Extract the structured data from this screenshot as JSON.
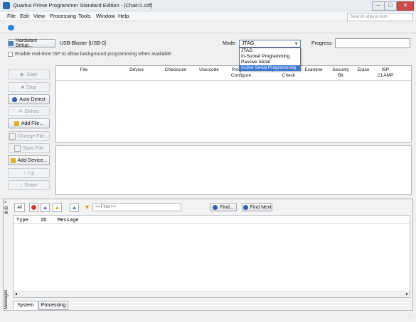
{
  "window": {
    "title": "Quartus Prime Programmer Standard Edition - [Chain1.cdf]",
    "min_label": "–",
    "max_label": "□",
    "close_label": "✕"
  },
  "menu": [
    "File",
    "Edit",
    "View",
    "Processing",
    "Tools",
    "Window",
    "Help"
  ],
  "search": {
    "placeholder": "Search altera.com"
  },
  "hardware": {
    "setup_label": "Hardware Setup...",
    "device": "USB-Blaster [USB-0]",
    "isp_label": "Enable real-time ISP to allow background programming when available"
  },
  "mode": {
    "label": "Mode:",
    "selected": "JTAG",
    "options": [
      "JTAG",
      "In-Socket Programming",
      "Passive Serial",
      "Active Serial Programming"
    ],
    "highlighted_index": 3
  },
  "progress_label": "Progress:",
  "side_buttons": {
    "start": "Start",
    "stop": "Stop",
    "auto_detect": "Auto Detect",
    "delete": "Delete",
    "add_file": "Add File...",
    "change_file": "Change File...",
    "save_file": "Save File",
    "add_device": "Add Device...",
    "up": "Up",
    "down": "Down"
  },
  "columns": {
    "file": "File",
    "device": "Device",
    "checksum": "Checksum",
    "usercode": "Usercode",
    "program_l1": "Program/",
    "program_l2": "Configure",
    "verify": "Verify",
    "blank_l1": "Blank-",
    "blank_l2": "Check",
    "examine": "Examine",
    "security_l1": "Security",
    "security_l2": "Bit",
    "erase": "Erase",
    "isp_l1": "ISP",
    "isp_l2": "CLAMP"
  },
  "messages": {
    "all_label": "All",
    "filter_placeholder": "<<Filter>>",
    "find_label": "Find...",
    "find_next_label": "Find Next",
    "col_type": "Type",
    "col_id": "ID",
    "col_message": "Message",
    "side_label": "Messages",
    "tabs": [
      "System",
      "Processing"
    ]
  },
  "colors": {
    "accent": "#3a78d4",
    "error": "#d23b3b",
    "warning": "#e3a81a",
    "info": "#5a6cc7"
  }
}
